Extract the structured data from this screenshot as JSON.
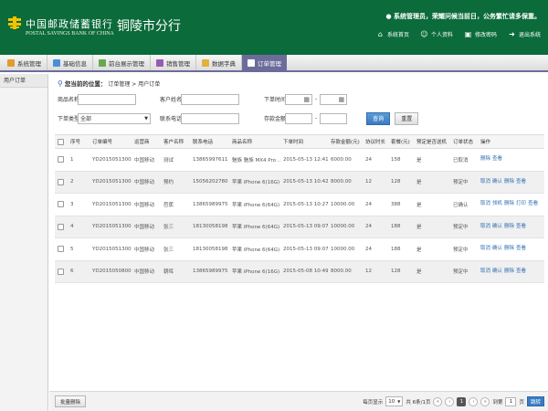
{
  "header": {
    "logo_cn": "中国邮政储蓄银行",
    "logo_en": "POSTAL SAVINGS BANK OF CHINA",
    "branch": "铜陵市分行",
    "welcome": "系统管理员，荣耀问候当前日，公务繁忙请多保重。",
    "links": [
      {
        "label": "系统首页",
        "icon": "home-icon"
      },
      {
        "label": "个人资料",
        "icon": "user-icon"
      },
      {
        "label": "修改密码",
        "icon": "lock-icon"
      },
      {
        "label": "退出系统",
        "icon": "exit-icon"
      }
    ],
    "bg_color": "#0b6b3a"
  },
  "nav": {
    "items": [
      {
        "label": "系统管理",
        "color": "#e39a2e"
      },
      {
        "label": "基础信息",
        "color": "#4a90d9"
      },
      {
        "label": "前台展示管理",
        "color": "#6aa84f"
      },
      {
        "label": "销售管理",
        "color": "#9b59b6"
      },
      {
        "label": "数据字典",
        "color": "#e0b23a"
      },
      {
        "label": "订单管理",
        "color": "#ffffff"
      }
    ],
    "active_index": 5,
    "accent": "#6c6c9a"
  },
  "sidebar": {
    "items": [
      {
        "label": "用户订单"
      }
    ]
  },
  "breadcrumb": {
    "label": "您当前的位置：",
    "path": "订单管理 > 用户订单"
  },
  "filters": {
    "product_name_label": "商品名称",
    "customer_name_label": "客户姓名",
    "order_time_label": "下单时间",
    "order_type_label": "下单类型",
    "order_type_value": "全部",
    "phone_label": "联系电话",
    "deposit_label": "存款金额",
    "range_sep": "-",
    "search_button": "查询",
    "reset_button": "重置"
  },
  "table": {
    "columns": [
      "",
      "序号",
      "订单编号",
      "运营商",
      "客户名称",
      "联系电话",
      "商品名称",
      "下单时间",
      "存款金额(元)",
      "协议时长",
      "套餐(元)",
      "预定是否送机",
      "订单状态",
      "操作"
    ],
    "rows": [
      {
        "no": "1",
        "order": "YD20150513005",
        "carrier": "中国移动",
        "customer": "测试",
        "phone": "13865997611",
        "product": "魅族 魅族 MX4 Pro ...",
        "time": "2015-05-13 12:41:11",
        "deposit": "6000.00",
        "term": "24",
        "plan": "158",
        "gift": "是",
        "status": "已取消",
        "ops": [
          "删除",
          "查看"
        ]
      },
      {
        "no": "2",
        "order": "YD20150513004",
        "carrier": "中国移动",
        "customer": "预约",
        "phone": "15056202780",
        "product": "苹果 iPhone 6(16G)",
        "time": "2015-05-13 10:42:48",
        "deposit": "8000.00",
        "term": "12",
        "plan": "128",
        "gift": "是",
        "status": "预定中",
        "ops": [
          "取消",
          "确认",
          "删除",
          "查看"
        ]
      },
      {
        "no": "3",
        "order": "YD20150513003",
        "carrier": "中国移动",
        "customer": "芭蕉",
        "phone": "13865989975",
        "product": "苹果 iPhone 6(64G)",
        "time": "2015-05-13 10:27:15",
        "deposit": "10000.00",
        "term": "24",
        "plan": "388",
        "gift": "是",
        "status": "已确认",
        "ops": [
          "取消",
          "领机",
          "删除",
          "打印",
          "查看"
        ]
      },
      {
        "no": "4",
        "order": "YD20150513002",
        "carrier": "中国移动",
        "customer": "张三",
        "phone": "18130058198",
        "product": "苹果 iPhone 6(64G)",
        "time": "2015-05-13 09:07:33",
        "deposit": "10000.00",
        "term": "24",
        "plan": "188",
        "gift": "是",
        "status": "预定中",
        "ops": [
          "取消",
          "确认",
          "删除",
          "查看"
        ]
      },
      {
        "no": "5",
        "order": "YD20150513001",
        "carrier": "中国移动",
        "customer": "张三",
        "phone": "18130058198",
        "product": "苹果 iPhone 6(64G)",
        "time": "2015-05-13 09:07:30",
        "deposit": "10000.00",
        "term": "24",
        "plan": "188",
        "gift": "是",
        "status": "预定中",
        "ops": [
          "取消",
          "确认",
          "删除",
          "查看"
        ]
      },
      {
        "no": "6",
        "order": "YD20150508001",
        "carrier": "中国移动",
        "customer": "朝晖",
        "phone": "13865989975",
        "product": "苹果 iPhone 6(16G)",
        "time": "2015-05-08 10:49:30",
        "deposit": "8000.00",
        "term": "12",
        "plan": "128",
        "gift": "是",
        "status": "预定中",
        "ops": [
          "取消",
          "确认",
          "删除",
          "查看"
        ]
      }
    ]
  },
  "footer": {
    "batch_delete": "批量删除",
    "per_page_label": "每页显示",
    "per_page_value": "10",
    "total_text": "共 6条/1页",
    "current_page": "1",
    "goto_label": "到第",
    "goto_value": "1",
    "page_unit": "页",
    "go_button": "跳转"
  }
}
